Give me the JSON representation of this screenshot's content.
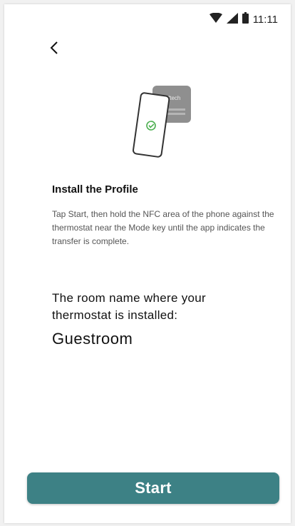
{
  "status_bar": {
    "time": "11:11",
    "icons": [
      "wifi-icon",
      "signal-icon",
      "battery-icon"
    ]
  },
  "nav": {
    "back_icon": "chevron-left-icon"
  },
  "hero": {
    "device_label": "ftech"
  },
  "content": {
    "title": "Install the Profile",
    "description": "Tap Start, then hold the NFC area of the phone against the thermostat near the Mode key until the app indicates the transfer is complete.",
    "room_label": "The room name where your thermostat is installed:",
    "room_name": "Guestroom"
  },
  "actions": {
    "start_label": "Start"
  },
  "colors": {
    "accent": "#3d8185",
    "check": "#4caf50"
  }
}
